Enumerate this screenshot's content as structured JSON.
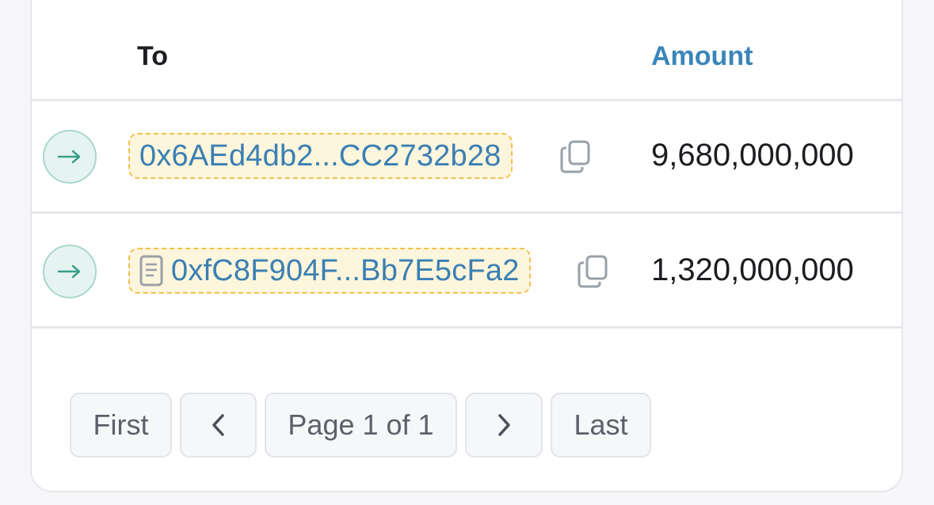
{
  "table": {
    "headers": {
      "to": "To",
      "amount": "Amount"
    },
    "colors": {
      "amount_header": "#3a86b9",
      "address": "#3a7fb3",
      "address_bg": "#fdf5dc",
      "address_border": "#f2c14e",
      "direction_icon": "#3aa08a"
    },
    "rows": [
      {
        "direction_icon": "arrow-right-icon",
        "address": "0x6AEd4db2...CC2732b28",
        "has_contract_icon": false,
        "amount": "9,680,000,000"
      },
      {
        "direction_icon": "arrow-right-icon",
        "address": "0xfC8F904F...Bb7E5cFa2",
        "has_contract_icon": true,
        "amount": "1,320,000,000"
      }
    ]
  },
  "pagination": {
    "first": "First",
    "prev_icon": "chevron-left-icon",
    "page": "Page 1 of 1",
    "next_icon": "chevron-right-icon",
    "last": "Last"
  }
}
